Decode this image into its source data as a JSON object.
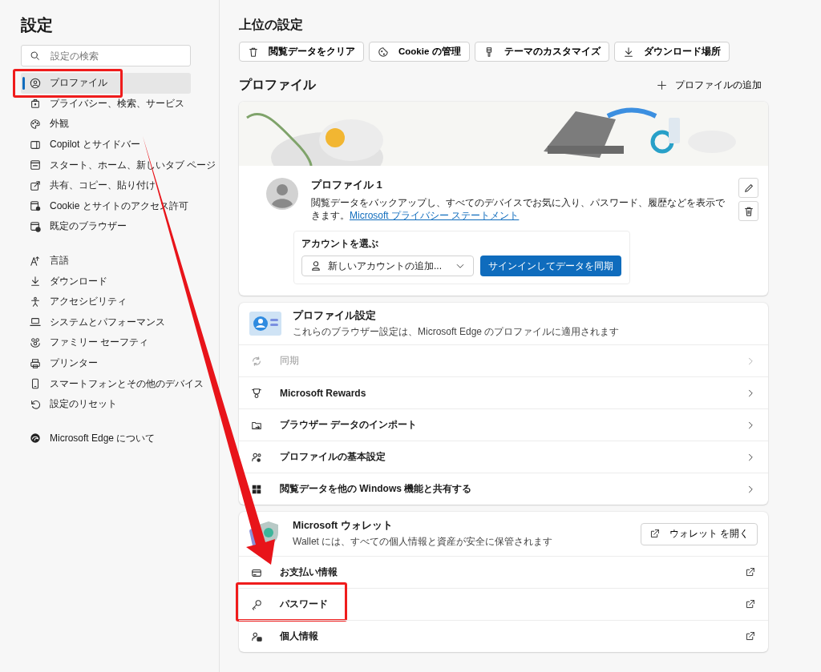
{
  "sidebar": {
    "title": "設定",
    "search": {
      "placeholder": "設定の検索"
    },
    "sections": [
      {
        "items": [
          {
            "label": "プロファイル",
            "selected": true,
            "highlighted": true
          },
          {
            "label": "プライバシー、検索、サービス",
            "selected": false,
            "highlighted": false
          },
          {
            "label": "外観",
            "selected": false,
            "highlighted": false
          },
          {
            "label": "Copilot とサイドバー",
            "selected": false,
            "highlighted": false
          },
          {
            "label": "スタート、ホーム、新しいタブ ページ",
            "selected": false,
            "highlighted": false
          },
          {
            "label": "共有、コピー、貼り付け",
            "selected": false,
            "highlighted": false
          },
          {
            "label": "Cookie とサイトのアクセス許可",
            "selected": false,
            "highlighted": false
          },
          {
            "label": "既定のブラウザー",
            "selected": false,
            "highlighted": false
          }
        ]
      },
      {
        "items": [
          {
            "label": "言語",
            "selected": false,
            "highlighted": false
          },
          {
            "label": "ダウンロード",
            "selected": false,
            "highlighted": false
          },
          {
            "label": "アクセシビリティ",
            "selected": false,
            "highlighted": false
          },
          {
            "label": "システムとパフォーマンス",
            "selected": false,
            "highlighted": false
          },
          {
            "label": "ファミリー セーフティ",
            "selected": false,
            "highlighted": false
          },
          {
            "label": "プリンター",
            "selected": false,
            "highlighted": false
          },
          {
            "label": "スマートフォンとその他のデバイス",
            "selected": false,
            "highlighted": false
          },
          {
            "label": "設定のリセット",
            "selected": false,
            "highlighted": false
          }
        ]
      },
      {
        "items": [
          {
            "label": "Microsoft Edge について",
            "selected": false,
            "highlighted": false
          }
        ]
      }
    ]
  },
  "top_settings": {
    "title": "上位の設定",
    "buttons": [
      "閲覧データをクリア",
      "Cookie の管理",
      "テーマのカスタマイズ",
      "ダウンロード場所"
    ]
  },
  "profile": {
    "title": "プロファイル",
    "add_button": "プロファイルの追加",
    "name": "プロファイル 1",
    "description": "閲覧データをバックアップし、すべてのデバイスでお気に入り、パスワード、履歴などを表示できます。",
    "link": "Microsoft プライバシー ステートメント",
    "account": {
      "label": "アカウントを選ぶ",
      "dropdown": "新しいアカウントの追加...",
      "sign_in_button": "サインインしてデータを同期"
    }
  },
  "profile_settings": {
    "title": "プロファイル設定",
    "subtitle": "これらのブラウザー設定は、Microsoft Edge のプロファイルに適用されます",
    "rows": [
      {
        "label": "同期",
        "disabled": true,
        "highlighted": false
      },
      {
        "label": "Microsoft Rewards",
        "disabled": false,
        "highlighted": false
      },
      {
        "label": "ブラウザー データのインポート",
        "disabled": false,
        "highlighted": false
      },
      {
        "label": "プロファイルの基本設定",
        "disabled": false,
        "highlighted": false
      },
      {
        "label": "閲覧データを他の Windows 機能と共有する",
        "disabled": false,
        "highlighted": false
      }
    ]
  },
  "wallet": {
    "title": "Microsoft ウォレット",
    "subtitle": "Wallet には、すべての個人情報と資産が安全に保管されます",
    "open_button": "ウォレット を開く",
    "rows": [
      {
        "label": "お支払い情報",
        "disabled": false,
        "highlighted": false
      },
      {
        "label": "パスワード",
        "disabled": false,
        "highlighted": true
      },
      {
        "label": "個人情報",
        "disabled": false,
        "highlighted": false
      }
    ]
  }
}
